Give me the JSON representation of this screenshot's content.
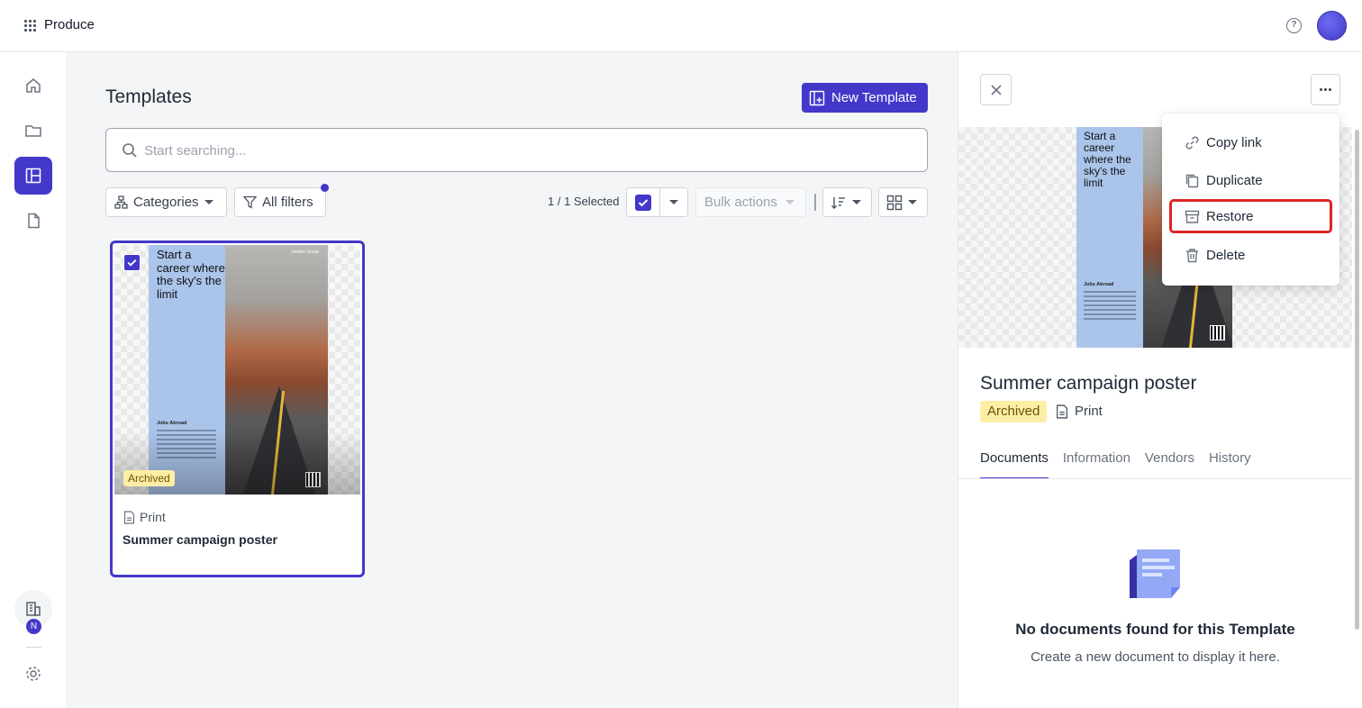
{
  "app": {
    "name": "Produce"
  },
  "main": {
    "title": "Templates",
    "new_template_label": "New Template",
    "search": {
      "placeholder": "Start searching...",
      "value": ""
    },
    "filters": {
      "categories_label": "Categories",
      "all_filters_label": "All filters"
    },
    "selection": {
      "count_label": "1 / 1 Selected"
    },
    "bulk_actions_label": "Bulk actions"
  },
  "card": {
    "badge": "Archived",
    "type": "Print",
    "name": "Summer campaign poster",
    "selected": true,
    "poster": {
      "headline": "Start a career where the sky's the limit",
      "subheading": "Jobs Abroad",
      "logo_text": "Veritas Group",
      "footer": "veritas.com"
    }
  },
  "panel": {
    "title": "Summer campaign poster",
    "badge": "Archived",
    "type": "Print",
    "tabs": [
      {
        "label": "Documents",
        "active": true
      },
      {
        "label": "Information",
        "active": false
      },
      {
        "label": "Vendors",
        "active": false
      },
      {
        "label": "History",
        "active": false
      }
    ],
    "empty_title": "No documents found for this Template",
    "empty_subtitle": "Create a new document to display it here."
  },
  "menu": {
    "items": [
      {
        "label": "Copy link",
        "icon": "link-icon"
      },
      {
        "label": "Duplicate",
        "icon": "duplicate-icon"
      },
      {
        "label": "Restore",
        "icon": "archive-restore-icon",
        "highlighted": true
      },
      {
        "label": "Delete",
        "icon": "trash-icon"
      }
    ]
  },
  "rail": {
    "org_initial": "N"
  },
  "colors": {
    "accent": "#4338ca",
    "archived_badge": "#fdeea6",
    "highlight": "#dc2626"
  }
}
